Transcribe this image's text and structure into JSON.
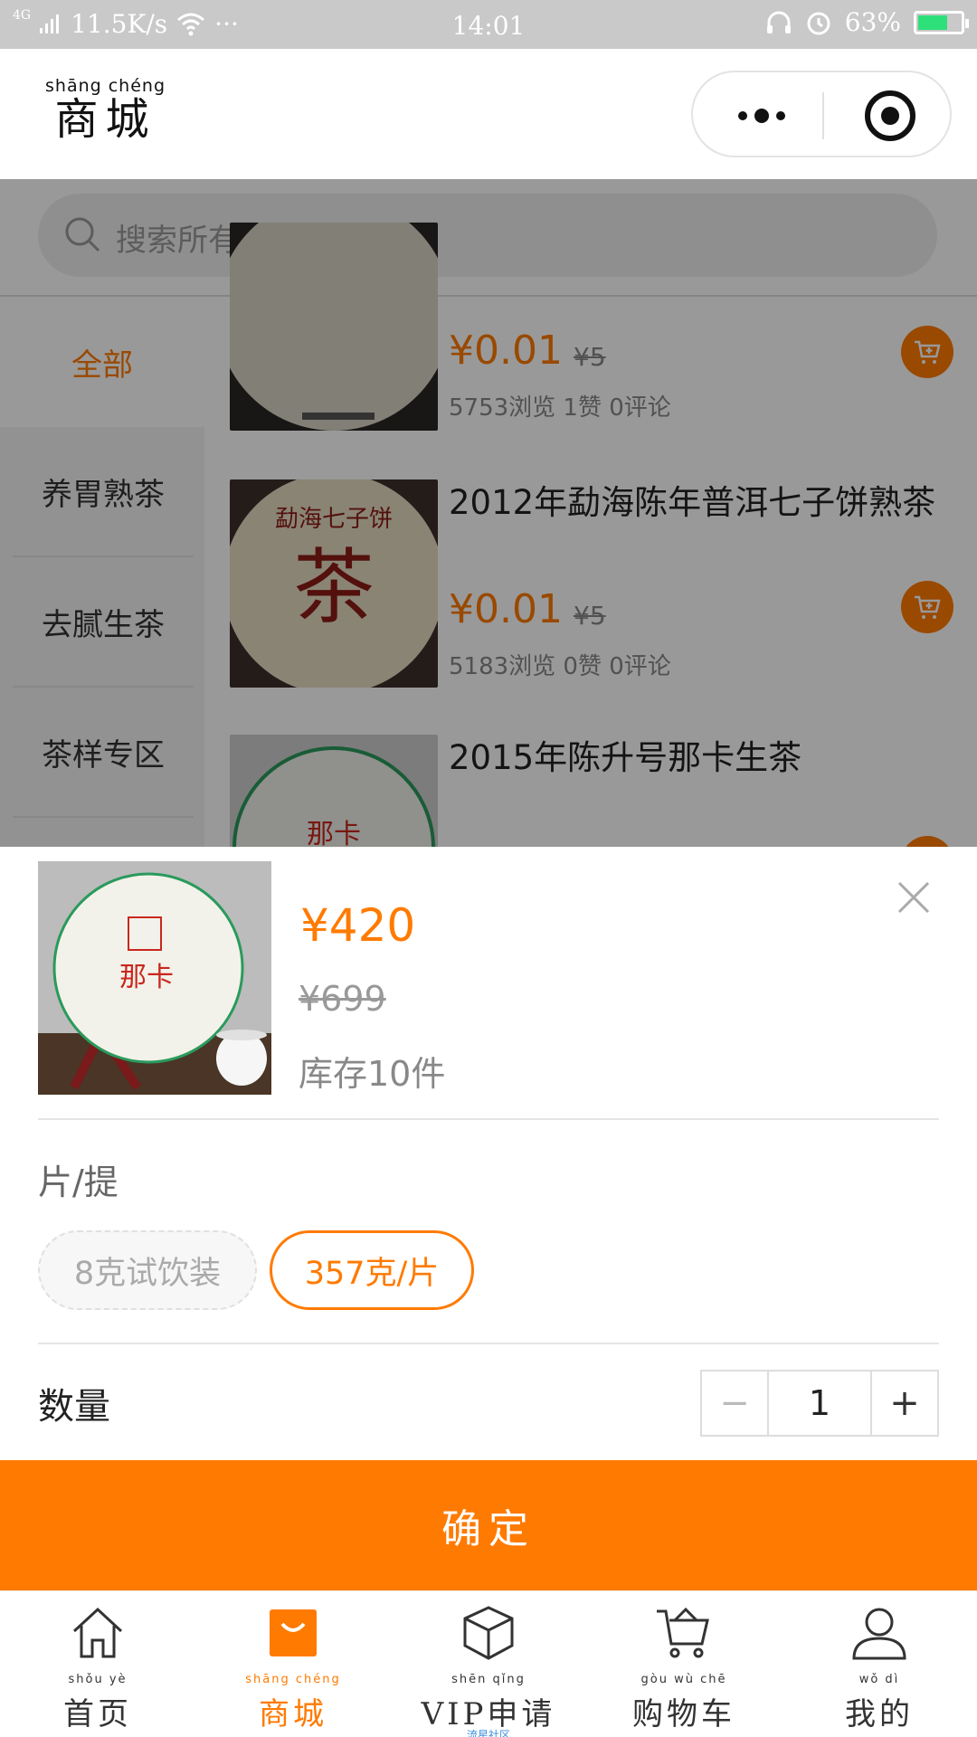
{
  "status_bar": {
    "network": "4G",
    "speed": "11.5K/s",
    "dots": "···",
    "time": "14:01",
    "battery": "63%"
  },
  "header": {
    "title_pinyin": "shāng chéng",
    "title": "商城"
  },
  "search": {
    "placeholder": "搜索所有商品"
  },
  "sidebar": {
    "items": [
      {
        "label": "全部",
        "active": true
      },
      {
        "label": "养胃熟茶",
        "active": false
      },
      {
        "label": "去腻生茶",
        "active": false
      },
      {
        "label": "茶样专区",
        "active": false
      }
    ]
  },
  "products": [
    {
      "name": "",
      "price": "¥0.01",
      "old_price": "¥5",
      "stats": "5753浏览  1赞  0评论"
    },
    {
      "name": "2012年勐海陈年普洱七子饼熟茶",
      "price": "¥0.01",
      "old_price": "¥5",
      "stats": "5183浏览  0赞  0评论"
    },
    {
      "name": "2015年陈升号那卡生茶",
      "price": "",
      "old_price": "",
      "stats": ""
    }
  ],
  "modal": {
    "price": "¥420",
    "old_price": "¥699",
    "stock": "库存10件",
    "spec_label": "片/提",
    "options": [
      {
        "label": "8克试饮装",
        "state": "disabled"
      },
      {
        "label": "357克/片",
        "state": "selected"
      }
    ],
    "quantity_label": "数量",
    "quantity": "1",
    "minus": "−",
    "plus": "+",
    "confirm": "确定"
  },
  "tabbar": {
    "items": [
      {
        "pinyin": "shǒu  yè",
        "label": "首页",
        "icon": "home-icon",
        "active": false
      },
      {
        "pinyin": "shāng chéng",
        "label": "商城",
        "icon": "shop-bag-icon",
        "active": true
      },
      {
        "pinyin": "shēn   qǐng",
        "label": "VIP申请",
        "icon": "box-icon",
        "active": false,
        "sub": "流星社区"
      },
      {
        "pinyin": "gòu   wù   chē",
        "label": "购物车",
        "icon": "cart-icon",
        "active": false
      },
      {
        "pinyin": "wǒ    dì",
        "label": "我的",
        "icon": "user-icon",
        "active": false
      }
    ]
  },
  "colors": {
    "accent": "#ff7a00",
    "status_bar": "#c9c9c9",
    "link_blue": "#3a8fe0"
  }
}
